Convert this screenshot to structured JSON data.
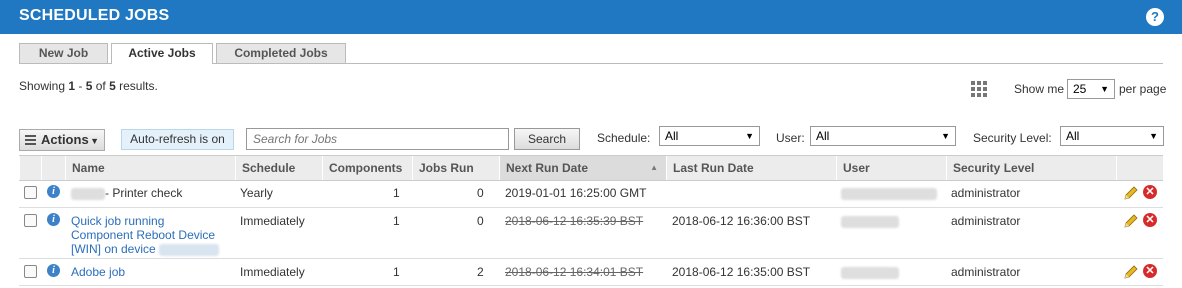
{
  "header": {
    "title": "SCHEDULED JOBS",
    "help_label": "?"
  },
  "tabs": [
    {
      "label": "New Job"
    },
    {
      "label": "Active Jobs",
      "active": true
    },
    {
      "label": "Completed Jobs"
    }
  ],
  "results": {
    "prefix": "Showing ",
    "from": "1",
    "sep": " - ",
    "to": "5",
    "of_text": " of ",
    "total": "5",
    "suffix": " results."
  },
  "paging": {
    "show_me_label": "Show me",
    "per_page_value": "25",
    "per_page_label": "per page"
  },
  "toolbar": {
    "actions_label": "Actions",
    "auto_refresh_label": "Auto-refresh is on",
    "search_placeholder": "Search for Jobs",
    "search_button": "Search",
    "schedule_label": "Schedule:",
    "schedule_value": "All",
    "user_label": "User:",
    "user_value": "All",
    "security_label": "Security Level:",
    "security_value": "All"
  },
  "table": {
    "columns": [
      "Name",
      "Schedule",
      "Components",
      "Jobs Run",
      "Next Run Date",
      "Last Run Date",
      "User",
      "Security Level"
    ],
    "rows": [
      {
        "name_suffix": "- Printer check",
        "schedule": "Yearly",
        "components": "1",
        "jobs_run": "0",
        "next_run": "2019-01-01 16:25:00 GMT",
        "last_run": "",
        "security": "administrator"
      },
      {
        "name_line1": "Quick job running",
        "name_line2": "Component Reboot Device",
        "name_line3": "[WIN] on device",
        "schedule": "Immediately",
        "components": "1",
        "jobs_run": "0",
        "next_run": "2018-06-12 16:35:39 BST",
        "last_run": "2018-06-12 16:36:00 BST",
        "security": "administrator"
      },
      {
        "name": "Adobe job",
        "schedule": "Immediately",
        "components": "1",
        "jobs_run": "2",
        "next_run": "2018-06-12 16:34:01 BST",
        "last_run": "2018-06-12 16:35:00 BST",
        "security": "administrator"
      }
    ]
  },
  "colors": {
    "header_bg": "#1f78c1",
    "link": "#2a6ebb",
    "delete": "#d62b2b",
    "edit": "#e8b820"
  }
}
